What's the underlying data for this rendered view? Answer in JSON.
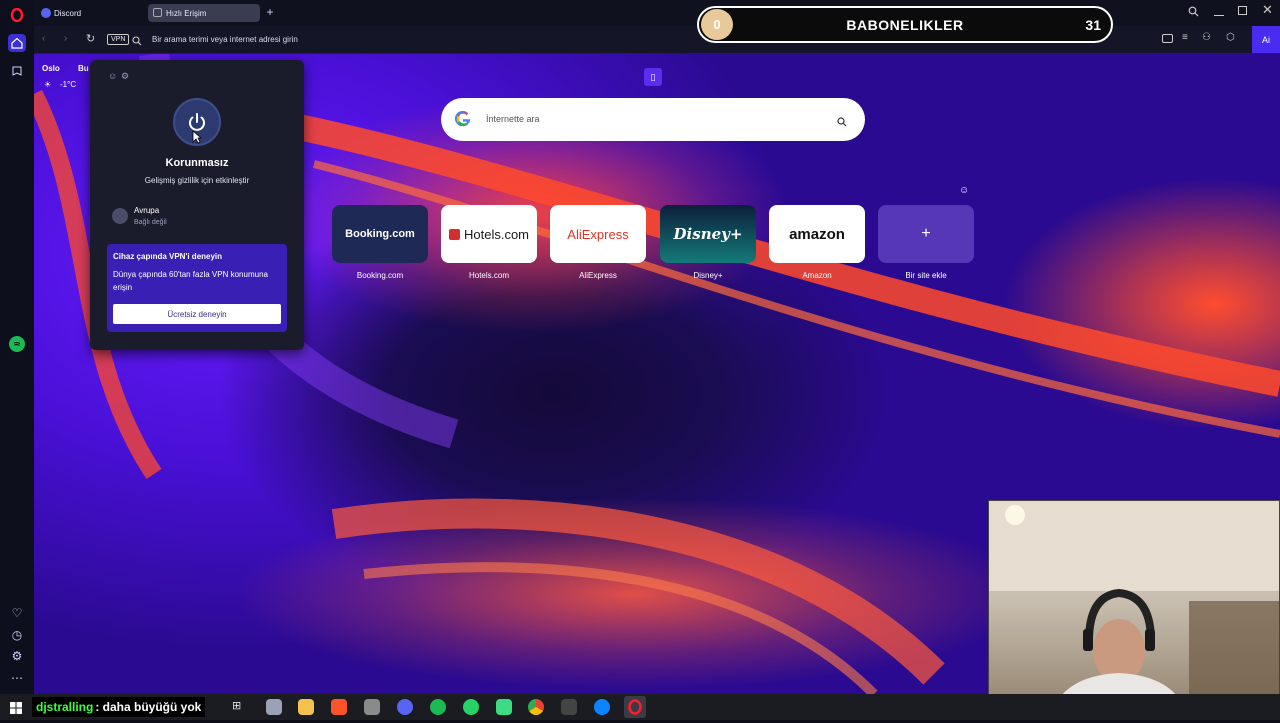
{
  "browser": {
    "tabs": [
      {
        "label": "Discord"
      },
      {
        "label": "Hızlı Erişim"
      }
    ],
    "vpn_badge": "VPN",
    "address_placeholder": "Bir arama terimi veya internet adresi girin",
    "ai_label": "Ai"
  },
  "weather": {
    "city": "Oslo",
    "temp": "-1°C",
    "next_city": "Bu"
  },
  "subscriber_bar": {
    "left_count": "0",
    "title": "BABONELIKLER",
    "right_count": "31"
  },
  "vpn_panel": {
    "status": "Korunmasız",
    "status_sub": "Gelişmiş gizlilik için etkinleştir",
    "location_name": "Avrupa",
    "location_status": "Bağlı değil",
    "promo_title": "Cihaz çapında VPN'i deneyin",
    "promo_text": "Dünya çapında 60'tan fazla VPN konumuna erişin",
    "promo_button": "Ücretsiz deneyin"
  },
  "search": {
    "placeholder": "İnternette ara"
  },
  "speed_dials": [
    {
      "tile": "Booking.com",
      "label": "Booking.com",
      "bg": "#1e2a55",
      "fg": "#ffffff"
    },
    {
      "tile": "Hotels.com",
      "label": "Hotels.com",
      "bg": "#ffffff",
      "fg": "#1a1a1a"
    },
    {
      "tile": "AliExpress",
      "label": "AliExpress",
      "bg": "#ffffff",
      "fg": "#e43225"
    },
    {
      "tile": "Disney+",
      "label": "Disney+",
      "bg": "#0f4c5c",
      "fg": "#ffffff"
    },
    {
      "tile": "amazon",
      "label": "Amazon",
      "bg": "#ffffff",
      "fg": "#111111"
    },
    {
      "tile": "+",
      "label": "Bir site ekle",
      "bg": "rgba(170,140,255,0.35)",
      "fg": "#ffffff"
    }
  ],
  "chat_overlay": {
    "user": "djstralling",
    "message": ": daha büyüğü yok"
  },
  "colors": {
    "accent": "#5b3cff",
    "opera_red": "#ff1b2d",
    "subs_gold": "#e8c99a"
  }
}
